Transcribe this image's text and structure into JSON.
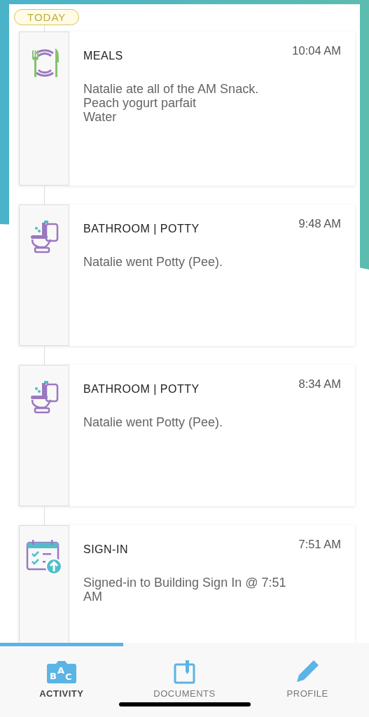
{
  "date_badge": "TODAY",
  "entries": [
    {
      "kind": "meals",
      "title": "MEALS",
      "time": "10:04 AM",
      "lines": [
        "Natalie ate all of the AM Snack.",
        "Peach yogurt parfait",
        "Water"
      ]
    },
    {
      "kind": "bathroom",
      "title": "BATHROOM | POTTY",
      "time": "9:48 AM",
      "lines": [
        "Natalie went Potty (Pee)."
      ]
    },
    {
      "kind": "bathroom",
      "title": "BATHROOM | POTTY",
      "time": "8:34 AM",
      "lines": [
        "Natalie went Potty (Pee)."
      ]
    },
    {
      "kind": "signin",
      "title": "SIGN-IN",
      "time": "7:51 AM",
      "lines": [
        "Signed-in to Building Sign In @ 7:51 AM"
      ]
    }
  ],
  "tabs": [
    {
      "kind": "activity",
      "label": "ACTIVITY",
      "selected": true,
      "icon_letters": [
        "B",
        "A",
        "C"
      ]
    },
    {
      "kind": "documents",
      "label": "DOCUMENTS",
      "selected": false
    },
    {
      "kind": "profile",
      "label": "PROFILE",
      "selected": false
    }
  ]
}
